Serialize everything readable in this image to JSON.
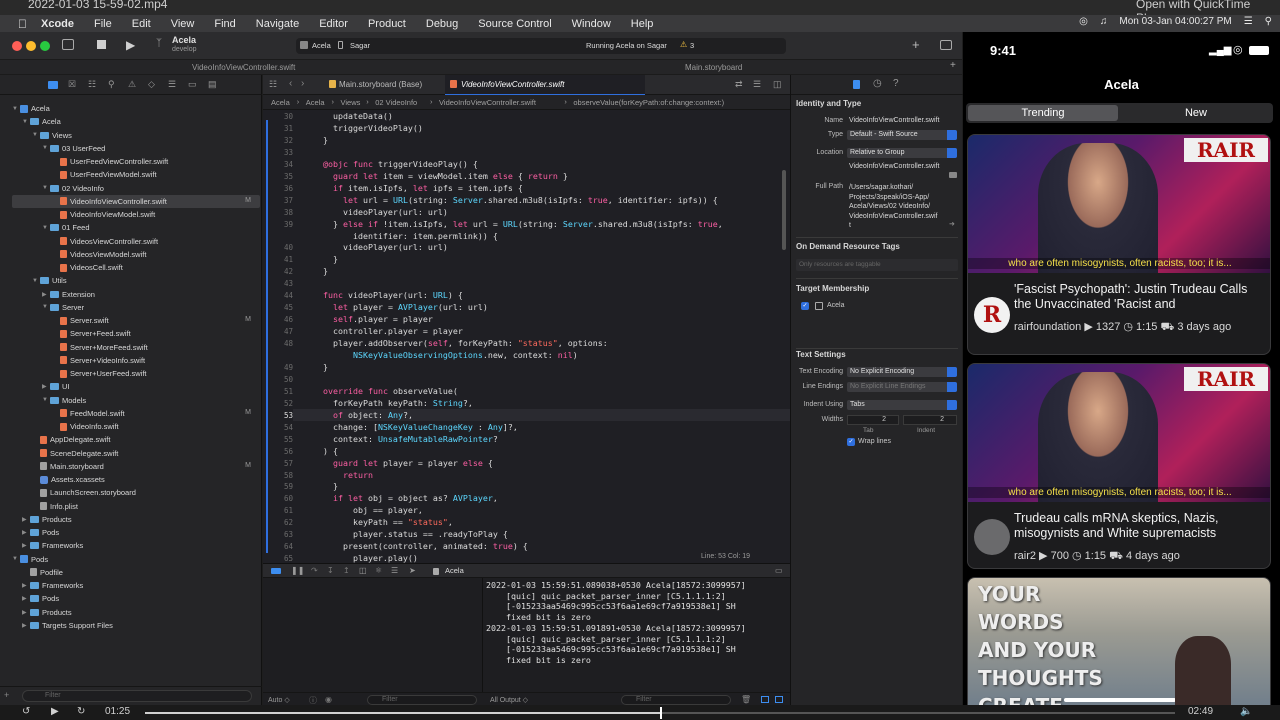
{
  "quicktime": {
    "title": "2022-01-03 15-59-02.mp4",
    "open_with": "Open with QuickTime Player",
    "elapsed": "01:25",
    "remaining": "02:49",
    "progress": 0.5
  },
  "menubar": {
    "app": "Xcode",
    "items": [
      "File",
      "Edit",
      "View",
      "Find",
      "Navigate",
      "Editor",
      "Product",
      "Debug",
      "Source Control",
      "Window",
      "Help"
    ],
    "clock": "Mon 03-Jan  04:00:27 PM"
  },
  "toolbar": {
    "project": "Acela",
    "branch": "develop",
    "scheme": "Acela",
    "device": "Sagar",
    "status": "Running Acela on Sagar",
    "warnings": "3"
  },
  "window_tabs": [
    "VideoInfoViewController.swift",
    "Main.storyboard"
  ],
  "navigator": {
    "rows": [
      {
        "label": "Acela",
        "depth": 0,
        "kind": "proj",
        "open": true
      },
      {
        "label": "Acela",
        "depth": 1,
        "kind": "folder",
        "open": true
      },
      {
        "label": "Views",
        "depth": 2,
        "kind": "folder",
        "open": true
      },
      {
        "label": "03 UserFeed",
        "depth": 3,
        "kind": "folder",
        "open": true
      },
      {
        "label": "UserFeedViewController.swift",
        "depth": 4,
        "kind": "swift"
      },
      {
        "label": "UserFeedViewModel.swift",
        "depth": 4,
        "kind": "swift"
      },
      {
        "label": "02 VideoInfo",
        "depth": 3,
        "kind": "folder",
        "open": true
      },
      {
        "label": "VideoInfoViewController.swift",
        "depth": 4,
        "kind": "swift",
        "badge": "M",
        "selected": true
      },
      {
        "label": "VideoInfoViewModel.swift",
        "depth": 4,
        "kind": "swift"
      },
      {
        "label": "01 Feed",
        "depth": 3,
        "kind": "folder",
        "open": true
      },
      {
        "label": "VideosViewController.swift",
        "depth": 4,
        "kind": "swift"
      },
      {
        "label": "VideosViewModel.swift",
        "depth": 4,
        "kind": "swift"
      },
      {
        "label": "VideosCell.swift",
        "depth": 4,
        "kind": "swift"
      },
      {
        "label": "Utils",
        "depth": 2,
        "kind": "folder",
        "open": true
      },
      {
        "label": "Extension",
        "depth": 3,
        "kind": "folder"
      },
      {
        "label": "Server",
        "depth": 3,
        "kind": "folder",
        "open": true
      },
      {
        "label": "Server.swift",
        "depth": 4,
        "kind": "swift",
        "badge": "M"
      },
      {
        "label": "Server+Feed.swift",
        "depth": 4,
        "kind": "swift"
      },
      {
        "label": "Server+MoreFeed.swift",
        "depth": 4,
        "kind": "swift"
      },
      {
        "label": "Server+VideoInfo.swift",
        "depth": 4,
        "kind": "swift"
      },
      {
        "label": "Server+UserFeed.swift",
        "depth": 4,
        "kind": "swift"
      },
      {
        "label": "UI",
        "depth": 3,
        "kind": "folder"
      },
      {
        "label": "Models",
        "depth": 3,
        "kind": "folder",
        "open": true
      },
      {
        "label": "FeedModel.swift",
        "depth": 4,
        "kind": "swift",
        "badge": "M"
      },
      {
        "label": "VideoInfo.swift",
        "depth": 4,
        "kind": "swift"
      },
      {
        "label": "AppDelegate.swift",
        "depth": 2,
        "kind": "swift"
      },
      {
        "label": "SceneDelegate.swift",
        "depth": 2,
        "kind": "swift"
      },
      {
        "label": "Main.storyboard",
        "depth": 2,
        "kind": "other",
        "badge": "M"
      },
      {
        "label": "Assets.xcassets",
        "depth": 2,
        "kind": "asset"
      },
      {
        "label": "LaunchScreen.storyboard",
        "depth": 2,
        "kind": "other"
      },
      {
        "label": "Info.plist",
        "depth": 2,
        "kind": "other"
      },
      {
        "label": "Products",
        "depth": 1,
        "kind": "folder"
      },
      {
        "label": "Pods",
        "depth": 1,
        "kind": "folder"
      },
      {
        "label": "Frameworks",
        "depth": 1,
        "kind": "folder"
      },
      {
        "label": "Pods",
        "depth": 0,
        "kind": "proj",
        "open": true
      },
      {
        "label": "Podfile",
        "depth": 1,
        "kind": "other"
      },
      {
        "label": "Frameworks",
        "depth": 1,
        "kind": "folder"
      },
      {
        "label": "Pods",
        "depth": 1,
        "kind": "folder"
      },
      {
        "label": "Products",
        "depth": 1,
        "kind": "folder"
      },
      {
        "label": "Targets Support Files",
        "depth": 1,
        "kind": "folder"
      }
    ],
    "filter_placeholder": "Filter"
  },
  "editor": {
    "tabs": [
      "Main.storyboard (Base)",
      "VideoInfoViewController.swift"
    ],
    "breadcrumb": [
      "Acela",
      "Acela",
      "Views",
      "02 VideoInfo",
      "VideoInfoViewController.swift",
      "observeValue(forKeyPath:of:change:context:)"
    ],
    "first_line": 30,
    "current_line": 53,
    "lines": [
      "    updateData()",
      "    triggerVideoPlay()",
      "  }",
      "",
      "  @objc func triggerVideoPlay() {",
      "    guard let item = viewModel.item else { return }",
      "    if item.isIpfs, let ipfs = item.ipfs {",
      "      let url = URL(string: Server.shared.m3u8(isIpfs: true, identifier: ipfs)) {",
      "      videoPlayer(url: url)",
      "    } else if !item.isIpfs, let url = URL(string: Server.shared.m3u8(isIpfs: true,",
      "        identifier: item.permlink)) {",
      "      videoPlayer(url: url)",
      "    }",
      "  }",
      "",
      "  func videoPlayer(url: URL) {",
      "    let player = AVPlayer(url: url)",
      "    self.player = player",
      "    controller.player = player",
      "    player.addObserver(self, forKeyPath: \"status\", options:",
      "        NSKeyValueObservingOptions.new, context: nil)",
      "  }",
      "",
      "  override func observeValue(",
      "    forKeyPath keyPath: String?,",
      "    of object: Any?,",
      "    change: [NSKeyValueChangeKey : Any]?,",
      "    context: UnsafeMutableRawPointer?",
      "  ) {",
      "    guard let player = player else {",
      "      return",
      "    }",
      "    if let obj = object as? AVPlayer,",
      "        obj == player,",
      "        keyPath == \"status\",",
      "        player.status == .readyToPlay {",
      "      present(controller, animated: true) {",
      "        player.play()"
    ],
    "line_numbers": [
      "30",
      "31",
      "32",
      "33",
      "34",
      "35",
      "36",
      "37",
      "38",
      "39",
      "",
      "40",
      "41",
      "42",
      "43",
      "44",
      "45",
      "46",
      "47",
      "48",
      "",
      "49",
      "50",
      "51",
      "52",
      "53",
      "54",
      "55",
      "56",
      "57",
      "58",
      "59",
      "60",
      "61",
      "62",
      "63",
      "64",
      "65"
    ],
    "status": "Line: 53  Col: 19"
  },
  "debug": {
    "target": "Acela",
    "console": [
      "2022-01-03 15:59:51.089038+0530 Acela[18572:3099957]",
      "    [quic] quic_packet_parser_inner [C5.1.1.1:2]",
      "    [-015233aa5469c995cc53f6aa1e69cf7a919538e1] SH",
      "    fixed bit is zero",
      "2022-01-03 15:59:51.091891+0530 Acela[18572:3099957]",
      "    [quic] quic_packet_parser_inner [C5.1.1.1:2]",
      "    [-015233aa5469c995cc53f6aa1e69cf7a919538e1] SH",
      "    fixed bit is zero"
    ],
    "auto_label": "Auto ◇",
    "filter_placeholder": "Filter",
    "output_label": "All Output ◇"
  },
  "inspector": {
    "identity_title": "Identity and Type",
    "name_label": "Name",
    "name_value": "VideoInfoViewController.swift",
    "type_label": "Type",
    "type_value": "Default - Swift Source",
    "location_label": "Location",
    "location_value": "Relative to Group",
    "location_file": "VideoInfoViewController.swift",
    "fullpath_label": "Full Path",
    "fullpath_value": "/Users/sagar.kothari/\nProjects/3speak/iOS-App/\nAcela/Views/02 VideoInfo/\nVideoInfoViewController.swif\nt",
    "odr_title": "On Demand Resource Tags",
    "odr_placeholder": "Only resources are taggable",
    "target_title": "Target Membership",
    "target_item": "Acela",
    "text_title": "Text Settings",
    "encoding_label": "Text Encoding",
    "encoding_value": "No Explicit Encoding",
    "endings_label": "Line Endings",
    "endings_value": "No Explicit Line Endings",
    "indent_label": "Indent Using",
    "indent_value": "Tabs",
    "widths_label": "Widths",
    "tab_value": "2",
    "indent_value_num": "2",
    "tab_caption": "Tab",
    "indent_caption": "Indent",
    "wrap_label": "Wrap lines"
  },
  "simulator": {
    "time": "9:41",
    "title": "Acela",
    "segments": [
      "Trending",
      "New"
    ],
    "cards": [
      {
        "caption": "who are often misogynists, often racists, too; it is...",
        "logo": "RAIR",
        "title": "'Fascist Psychopath': Justin Trudeau Calls the Unvaccinated 'Racist and",
        "meta": "rairfoundation ▶ 1327 ◷ 1:15 ⛟ 3 days ago"
      },
      {
        "caption": "who are often misogynists, often racists, too; it is...",
        "logo": "RAIR",
        "title": "Trudeau calls mRNA skeptics, Nazis, misogynists and White supremacists",
        "meta": "rair2 ▶ 700 ◷ 1:15 ⛟ 4 days ago"
      },
      {
        "caption": "YOUR WORDS AND YOUR THOUGHTS CREATE YOUR"
      }
    ]
  }
}
